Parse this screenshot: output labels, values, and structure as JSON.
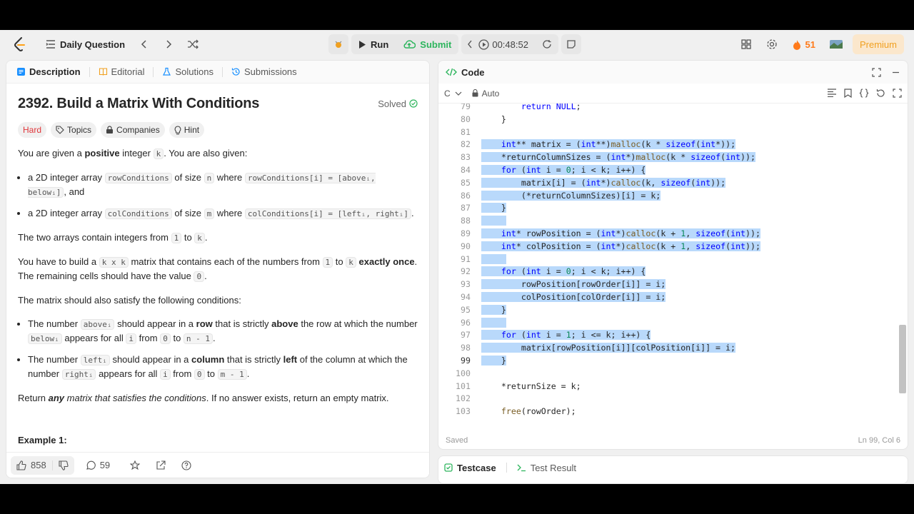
{
  "topbar": {
    "problem_list_label": "Daily Question",
    "run_label": "Run",
    "submit_label": "Submit",
    "timer": "00:48:52",
    "streak_count": "51",
    "premium_label": "Premium"
  },
  "left_tabs": [
    "Description",
    "Editorial",
    "Solutions",
    "Submissions"
  ],
  "problem": {
    "title": "2392. Build a Matrix With Conditions",
    "status": "Solved",
    "difficulty": "Hard",
    "chips": [
      "Topics",
      "Companies",
      "Hint"
    ],
    "intro_1": "You are given a ",
    "intro_bold": "positive",
    "intro_2": " integer ",
    "intro_k": "k",
    "intro_3": ". You are also given:",
    "b1_a": "a 2D integer array ",
    "b1_code1": "rowConditions",
    "b1_b": " of size ",
    "b1_code2": "n",
    "b1_c": " where ",
    "b1_code3": "rowConditions[i] = [aboveᵢ, belowᵢ]",
    "b1_d": ", and",
    "b2_a": "a 2D integer array ",
    "b2_code1": "colConditions",
    "b2_b": " of size ",
    "b2_code2": "m",
    "b2_c": " where ",
    "b2_code3": "colConditions[i] = [leftᵢ, rightᵢ]",
    "b2_d": ".",
    "p2_a": "The two arrays contain integers from ",
    "p2_c1": "1",
    "p2_b": " to ",
    "p2_c2": "k",
    "p2_c": ".",
    "p3_a": "You have to build a ",
    "p3_c1": "k x k",
    "p3_b": " matrix that contains each of the numbers from ",
    "p3_c2": "1",
    "p3_c": " to ",
    "p3_c3": "k",
    "p3_d": " ",
    "p3_bold": "exactly once",
    "p3_e": ". The remaining cells should have the value ",
    "p3_c4": "0",
    "p3_f": ".",
    "p4": "The matrix should also satisfy the following conditions:",
    "c1_a": "The number ",
    "c1_code1": "aboveᵢ",
    "c1_b": " should appear in a ",
    "c1_bold1": "row",
    "c1_c": " that is strictly ",
    "c1_bold2": "above",
    "c1_d": " the row at which the number ",
    "c1_code2": "belowᵢ",
    "c1_e": " appears for all ",
    "c1_code3": "i",
    "c1_f": " from ",
    "c1_code4": "0",
    "c1_g": " to ",
    "c1_code5": "n - 1",
    "c1_h": ".",
    "c2_a": "The number ",
    "c2_code1": "leftᵢ",
    "c2_b": " should appear in a ",
    "c2_bold1": "column",
    "c2_c": " that is strictly ",
    "c2_bold2": "left",
    "c2_d": " of the column at which the number ",
    "c2_code2": "rightᵢ",
    "c2_e": " appears for all ",
    "c2_code3": "i",
    "c2_f": " from ",
    "c2_code4": "0",
    "c2_g": " to ",
    "c2_code5": "m - 1",
    "c2_h": ".",
    "ret_a": "Return ",
    "ret_bi": "any",
    "ret_i": " matrix that satisfies the conditions",
    "ret_b": ". If no answer exists, return an empty matrix.",
    "example_heading": "Example 1:"
  },
  "left_footer": {
    "likes": "858",
    "comments": "59"
  },
  "code_panel": {
    "title": "Code",
    "language": "C",
    "mode": "Auto",
    "saved": "Saved",
    "cursor": "Ln 99, Col 6"
  },
  "code_lines": [
    {
      "n": "79",
      "t": "        return NULL;",
      "sel": false
    },
    {
      "n": "80",
      "t": "    }",
      "sel": false
    },
    {
      "n": "81",
      "t": "",
      "sel": false
    },
    {
      "n": "82",
      "t": "    int** matrix = (int**)malloc(k * sizeof(int*));",
      "sel": true
    },
    {
      "n": "83",
      "t": "    *returnColumnSizes = (int*)malloc(k * sizeof(int));",
      "sel": true
    },
    {
      "n": "84",
      "t": "    for (int i = 0; i < k; i++) {",
      "sel": true
    },
    {
      "n": "85",
      "t": "        matrix[i] = (int*)calloc(k, sizeof(int));",
      "sel": true
    },
    {
      "n": "86",
      "t": "        (*returnColumnSizes)[i] = k;",
      "sel": true
    },
    {
      "n": "87",
      "t": "    }",
      "sel": true
    },
    {
      "n": "88",
      "t": "",
      "sel": true
    },
    {
      "n": "89",
      "t": "    int* rowPosition = (int*)calloc(k + 1, sizeof(int));",
      "sel": true
    },
    {
      "n": "90",
      "t": "    int* colPosition = (int*)calloc(k + 1, sizeof(int));",
      "sel": true
    },
    {
      "n": "91",
      "t": "",
      "sel": true
    },
    {
      "n": "92",
      "t": "    for (int i = 0; i < k; i++) {",
      "sel": true
    },
    {
      "n": "93",
      "t": "        rowPosition[rowOrder[i]] = i;",
      "sel": true
    },
    {
      "n": "94",
      "t": "        colPosition[colOrder[i]] = i;",
      "sel": true
    },
    {
      "n": "95",
      "t": "    }",
      "sel": true
    },
    {
      "n": "96",
      "t": "",
      "sel": true
    },
    {
      "n": "97",
      "t": "    for (int i = 1; i <= k; i++) {",
      "sel": true
    },
    {
      "n": "98",
      "t": "        matrix[rowPosition[i]][colPosition[i]] = i;",
      "sel": true
    },
    {
      "n": "99",
      "t": "    }",
      "sel": true
    },
    {
      "n": "100",
      "t": "",
      "sel": false
    },
    {
      "n": "101",
      "t": "    *returnSize = k;",
      "sel": false
    },
    {
      "n": "102",
      "t": "",
      "sel": false
    },
    {
      "n": "103",
      "t": "    free(rowOrder);",
      "sel": false
    }
  ],
  "current_line": "99",
  "bottom_tabs": [
    "Testcase",
    "Test Result"
  ],
  "colors": {
    "submit_green": "#2db55d",
    "hard_red": "#e0363a",
    "selection": "#b9d9fb",
    "premium": "#f0a020",
    "flame": "#ff7a1a"
  }
}
